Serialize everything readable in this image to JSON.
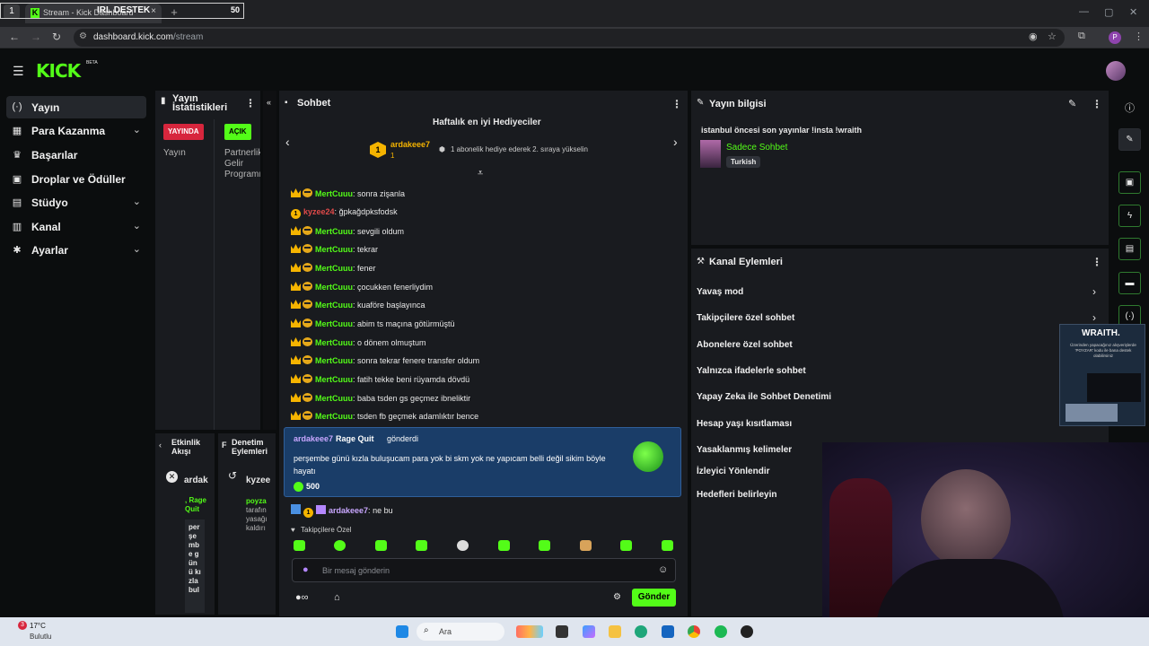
{
  "browser": {
    "tab_count": "1",
    "tab_title": "Stream - Kick Dashboard",
    "tab_close": "×",
    "new_tab": "+",
    "overlay_title": "IRL DESTEK",
    "overlay_count": "50",
    "url_host": "dashboard.kick.com",
    "url_path": "/stream",
    "profile_initial": "P"
  },
  "header": {
    "logo": "KICK",
    "logo_tag": "BETA"
  },
  "sidebar": {
    "items": [
      {
        "label": "Yayın",
        "icon": "(·)"
      },
      {
        "label": "Para Kazanma",
        "icon": "▦"
      },
      {
        "label": "Başarılar",
        "icon": "♛"
      },
      {
        "label": "Droplar ve Ödüller",
        "icon": "▣"
      },
      {
        "label": "Stüdyo",
        "icon": "▤"
      },
      {
        "label": "Kanal",
        "icon": "▥"
      },
      {
        "label": "Ayarlar",
        "icon": "✱"
      }
    ]
  },
  "stats": {
    "title": "Yayın İstatistikleri",
    "badge_live": "YAYINDA",
    "badge_open": "AÇIK",
    "col1_label": "Yayın",
    "col2_label": "Partnerlik Gelir Programı"
  },
  "activity": {
    "title": "Etkinlik Akışı",
    "user": "ardak",
    "raid_label": ", Rage Quit",
    "vertical_text": "perşembe günü kızla bul"
  },
  "moderation": {
    "title": "Denetim Eylemleri",
    "user": "kyzee",
    "line1": "poyza",
    "line2": "tarafın",
    "line3": "yasağı",
    "line4": "kaldırı"
  },
  "chat": {
    "title": "Sohbet",
    "gifters_title": "Haftalık en iyi Hediyeciler",
    "top_gifter": "ardakeee7",
    "top_gifter_count": "1",
    "top_gifter_rank": "1",
    "gifter_note": "1 abonelik hediye ederek 2. sıraya yükselin",
    "messages": [
      {
        "user": "MertCuuu",
        "text": "sonra zişanla"
      },
      {
        "user": "kyzee24",
        "text": "ğpkağdpksfodsk"
      },
      {
        "user": "MertCuuu",
        "text": "sevgili oldum"
      },
      {
        "user": "MertCuuu",
        "text": "tekrar"
      },
      {
        "user": "MertCuuu",
        "text": "fener"
      },
      {
        "user": "MertCuuu",
        "text": "çocukken fenerliydim"
      },
      {
        "user": "MertCuuu",
        "text": "kuaföre başlayınca"
      },
      {
        "user": "MertCuuu",
        "text": "abim ts maçına götürmüştü"
      },
      {
        "user": "MertCuuu",
        "text": "o dönem olmuştum"
      },
      {
        "user": "MertCuuu",
        "text": "sonra tekrar fenere transfer oldum"
      },
      {
        "user": "MertCuuu",
        "text": "fatih tekke beni rüyamda dövdü"
      },
      {
        "user": "MertCuuu",
        "text": "baba tsden gs geçmez ibneliktir"
      },
      {
        "user": "MertCuuu",
        "text": "tsden fb geçmek adamlıktır bence"
      }
    ],
    "highlight_user": "ardakeee7",
    "highlight_item": "Rage Quit",
    "highlight_verb": "gönderdi",
    "highlight_text": "perşembe günü kızla buluşucam para yok bi skm yok ne yapıcam belli değil sikim böyle hayatı",
    "highlight_amount": "500",
    "last_user": "ardakeee7",
    "last_text": "ne bu",
    "followers_only": "Takipçilere Özel",
    "input_placeholder": "Bir mesaj gönderin",
    "send_label": "Gönder"
  },
  "stream_info": {
    "title": "Yayın bilgisi",
    "stream_title": "istanbul öncesi son yayınlar !insta !wraith",
    "category": "Sadece Sohbet",
    "language": "Turkish"
  },
  "channel_actions": {
    "title": "Kanal Eylemleri",
    "items": [
      "Yavaş mod",
      "Takipçilere özel sohbet",
      "Abonelere özel sohbet",
      "Yalnızca ifadelerle sohbet",
      "Yapay Zeka ile Sohbet Denetimi",
      "Hesap yaşı kısıtlaması",
      "Yasaklanmış kelimeler",
      "İzleyici Yönlendir",
      "Hedefleri belirleyin"
    ]
  },
  "ad": {
    "brand": "WRAITH.",
    "text": "Üzerinden yapacağınız alışverişlerde 'POYZAR' kodu ile bana destek olabilirsiniz"
  },
  "taskbar": {
    "temperature": "17°C",
    "weather": "Bulutlu",
    "weather_badge": "3",
    "search_placeholder": "Ara"
  },
  "colors": {
    "accent": "#53fc18",
    "panel": "#191b1f",
    "bg": "#0b0d0e",
    "highlight": "#1a3d68"
  }
}
